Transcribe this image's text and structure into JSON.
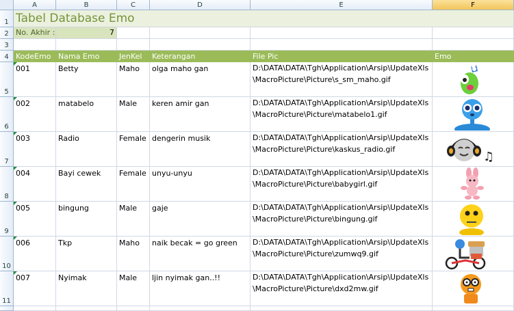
{
  "columns": [
    "A",
    "B",
    "C",
    "D",
    "E",
    "F"
  ],
  "rows": [
    "1",
    "2",
    "3",
    "4",
    "5",
    "6",
    "7",
    "8",
    "9",
    "10",
    "11"
  ],
  "title": "Tabel Database Emo",
  "last_no_label": "No. Akhir :",
  "last_no_value": "7",
  "headers": [
    "KodeEmo",
    "Nama Emo",
    "JenKel",
    "Keterangan",
    "File Pic",
    "Emo"
  ],
  "records": [
    {
      "kode": "001",
      "nama": "Betty",
      "jenkel": "Maho",
      "ket": "olga maho gan",
      "file": "D:\\DATA\\DATA\\Tgh\\Application\\Arsip\\UpdateXls\\MacroPicture\\Picture\\s_sm_maho.gif",
      "emo": "green-creature-icon"
    },
    {
      "kode": "002",
      "nama": "matabelo",
      "jenkel": "Male",
      "ket": "keren amir gan",
      "file": "D:\\DATA\\DATA\\Tgh\\Application\\Arsip\\UpdateXls\\MacroPicture\\Picture\\matabelo1.gif",
      "emo": "blue-big-eyes-icon"
    },
    {
      "kode": "003",
      "nama": "Radio",
      "jenkel": "Female",
      "ket": "dengerin musik",
      "file": "D:\\DATA\\DATA\\Tgh\\Application\\Arsip\\UpdateXls\\MacroPicture\\Picture\\kaskus_radio.gif",
      "emo": "headphones-radio-icon"
    },
    {
      "kode": "004",
      "nama": "Bayi cewek",
      "jenkel": "Female",
      "ket": "unyu-unyu",
      "file": "D:\\DATA\\DATA\\Tgh\\Application\\Arsip\\UpdateXls\\MacroPicture\\Picture\\babygirl.gif",
      "emo": "pink-bunny-icon"
    },
    {
      "kode": "005",
      "nama": "bingung",
      "jenkel": "Male",
      "ket": "gaje",
      "file": "D:\\DATA\\DATA\\Tgh\\Application\\Arsip\\UpdateXls\\MacroPicture\\Picture\\bingung.gif",
      "emo": "yellow-confused-icon"
    },
    {
      "kode": "006",
      "nama": "Tkp",
      "jenkel": "Maho",
      "ket": "naik becak = go green",
      "file": "D:\\DATA\\DATA\\Tgh\\Application\\Arsip\\UpdateXls\\MacroPicture\\Picture\\zumwq9.gif",
      "emo": "becak-rider-icon"
    },
    {
      "kode": "007",
      "nama": "Nyimak",
      "jenkel": "Male",
      "ket": "ljin nyimak gan..!!",
      "file": "D:\\DATA\\DATA\\Tgh\\Application\\Arsip\\UpdateXls\\MacroPicture\\Picture\\dxd2mw.gif",
      "emo": "orange-glasses-icon"
    }
  ],
  "colors": {
    "title_bg": "#ebf1de",
    "title_text": "#76933c",
    "header_bg": "#9bbb59",
    "label_bg": "#d8e4bc",
    "selected_col": "#f3c55b"
  }
}
